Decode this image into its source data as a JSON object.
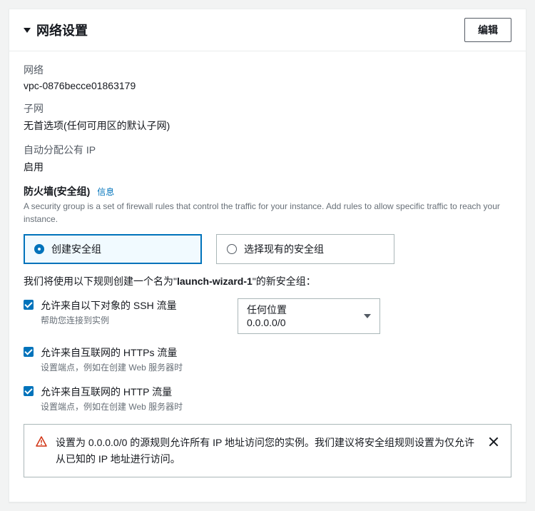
{
  "header": {
    "title": "网络设置",
    "edit_button": "编辑"
  },
  "fields": {
    "network": {
      "label": "网络",
      "value": "vpc-0876becce01863179"
    },
    "subnet": {
      "label": "子网",
      "value": "无首选项(任何可用区的默认子网)"
    },
    "auto_ip": {
      "label": "自动分配公有 IP",
      "value": "启用"
    }
  },
  "firewall": {
    "title": "防火墙(安全组)",
    "info": "信息",
    "desc": "A security group is a set of firewall rules that control the traffic for your instance. Add rules to allow specific traffic to reach your instance.",
    "options": {
      "create": "创建安全组",
      "select_existing": "选择现有的安全组"
    },
    "rule_desc_prefix": "我们将使用以下规则创建一个名为\"",
    "rule_name": "launch-wizard-1",
    "rule_desc_suffix": "\"的新安全组："
  },
  "rules": {
    "ssh": {
      "label": "允许来自以下对象的 SSH 流量",
      "sub": "帮助您连接到实例",
      "source": {
        "label": "任何位置",
        "value": "0.0.0.0/0"
      }
    },
    "https": {
      "label": "允许来自互联网的 HTTPs 流量",
      "sub": "设置端点，例如在创建 Web 服务器时"
    },
    "http": {
      "label": "允许来自互联网的 HTTP 流量",
      "sub": "设置端点，例如在创建 Web 服务器时"
    }
  },
  "alert": {
    "text": "设置为 0.0.0.0/0 的源规则允许所有 IP 地址访问您的实例。我们建议将安全组规则设置为仅允许从已知的 IP 地址进行访问。"
  }
}
